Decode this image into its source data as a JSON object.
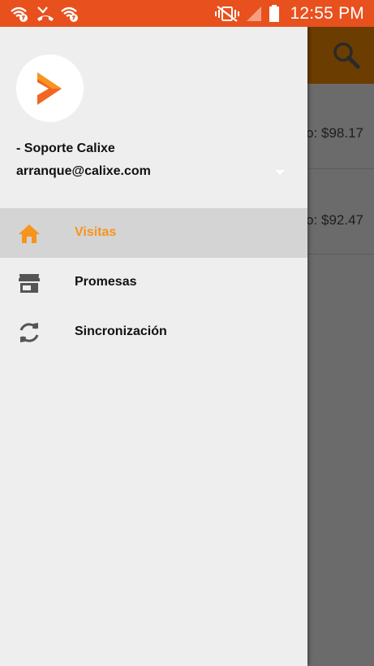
{
  "status_bar": {
    "time": "12:55 PM",
    "icons": [
      "wifi-call-icon",
      "missed-call-icon",
      "wifi-call-icon",
      "vibrate-mute-icon",
      "signal-icon",
      "battery-icon"
    ],
    "background_color": "#e8501e"
  },
  "background_app": {
    "toolbar_color": "#6b3d00",
    "search_icon": "search-icon",
    "rows": [
      {
        "amount_fragment": "o: $98.17"
      },
      {
        "amount_fragment": "o: $92.47"
      }
    ]
  },
  "drawer": {
    "accent_color": "#f7941d",
    "user": {
      "name": "- Soporte Calixe",
      "email": "arranque@calixe.com"
    },
    "menu": [
      {
        "label": "Visitas",
        "icon": "home-icon",
        "active": true
      },
      {
        "label": "Promesas",
        "icon": "store-icon",
        "active": false
      },
      {
        "label": "Sincronización",
        "icon": "sync-icon",
        "active": false
      }
    ]
  }
}
